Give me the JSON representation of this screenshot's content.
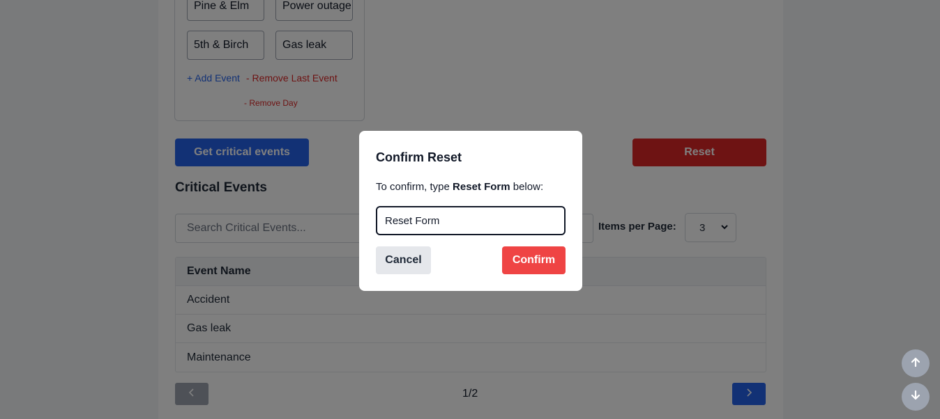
{
  "events_form": {
    "rows": [
      {
        "location": "Pine & Elm",
        "event": "Power outage"
      },
      {
        "location": "5th & Birch",
        "event": "Gas leak"
      }
    ],
    "add_event_label": "+ Add Event",
    "remove_last_label": "- Remove Last Event",
    "remove_day_label": "- Remove Day"
  },
  "actions": {
    "get_critical_label": "Get critical events",
    "reset_label": "Reset"
  },
  "critical": {
    "title": "Critical Events",
    "search_placeholder": "Search Critical Events...",
    "items_per_page_label": "Items per Page:",
    "items_per_page_value": "3",
    "table": {
      "header": "Event Name",
      "rows": [
        "Accident",
        "Gas leak",
        "Maintenance"
      ]
    },
    "pagination": {
      "text": "1/2"
    }
  },
  "modal": {
    "title": "Confirm Reset",
    "text_prefix": "To confirm, type ",
    "text_keyword": "Reset Form",
    "text_suffix": " below:",
    "input_value": "Reset Form",
    "cancel_label": "Cancel",
    "confirm_label": "Confirm"
  },
  "colors": {
    "primary": "#2563eb",
    "danger": "#dc2626",
    "confirm": "#ef4444",
    "overlay": "rgba(0,0,0,0.5)"
  },
  "icons": {
    "prev": "chevron-left-icon",
    "next": "chevron-right-icon",
    "scroll_up": "arrow-up-icon",
    "scroll_down": "arrow-down-icon",
    "select": "chevron-down-icon"
  }
}
